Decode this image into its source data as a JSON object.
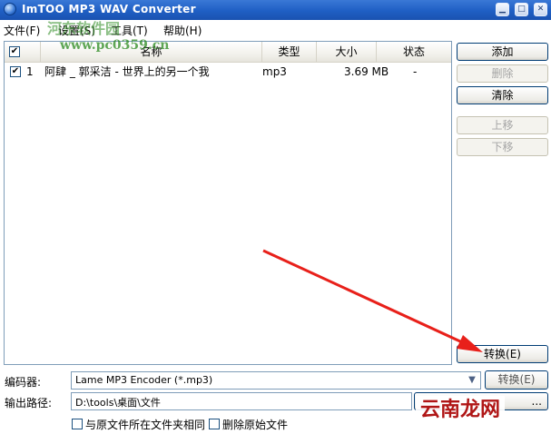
{
  "window": {
    "title": "ImTOO MP3 WAV Converter",
    "controls": [
      "minimize",
      "maximize",
      "close"
    ]
  },
  "menu": [
    {
      "label": "文件(F)"
    },
    {
      "label": "设置(S)"
    },
    {
      "label": "工具(T)"
    },
    {
      "label": "帮助(H)"
    }
  ],
  "watermark": {
    "line1": "河东软件园",
    "line2": "www.pc0359.cn",
    "bottom_logo": "云南龙网"
  },
  "file_list": {
    "columns": [
      "名称",
      "类型",
      "大小",
      "状态"
    ],
    "rows": [
      {
        "checked": true,
        "index": "1",
        "name": "阿肆 _ 郭采洁 - 世界上的另一个我",
        "type": "mp3",
        "size": "3.69 MB",
        "status": "-"
      }
    ]
  },
  "side_buttons": {
    "add": "添加",
    "delete": "删除",
    "clear": "清除",
    "move_up": "上移",
    "move_down": "下移",
    "convert": "转换(E)"
  },
  "bottom": {
    "encoder_label": "编码器:",
    "encoder_value": "Lame MP3 Encoder    (*.mp3)",
    "convert_small": "转换(E)",
    "output_label": "输出路径:",
    "output_path": "D:\\tools\\桌面\\文件",
    "browse_label": "...",
    "same_folder_label": "与原文件所在文件夹相同",
    "delete_original_label": "删除原始文件"
  },
  "colors": {
    "titlebar": "#1f5fc4",
    "annotation_arrow": "#e8201a",
    "watermark_green": "#2a8a1e"
  }
}
